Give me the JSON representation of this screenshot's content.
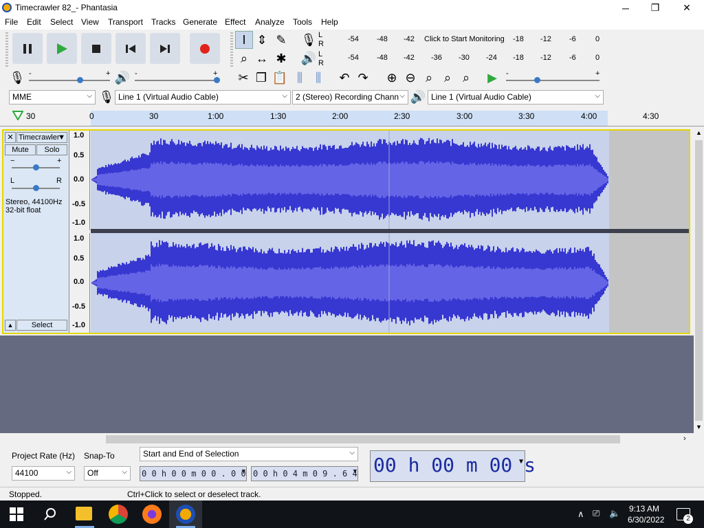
{
  "window": {
    "title": "Timecrawler 82_- Phantasia",
    "minimize": "─",
    "maximize": "❐",
    "close": "✕"
  },
  "menu": [
    "File",
    "Edit",
    "Select",
    "View",
    "Transport",
    "Tracks",
    "Generate",
    "Effect",
    "Analyze",
    "Tools",
    "Help"
  ],
  "meters": {
    "record_label_top": "L",
    "record_label_bottom": "R",
    "play_label_top": "L",
    "play_label_bottom": "R",
    "record_ticks": [
      "-54",
      "-48",
      "-42",
      "-18",
      "-12",
      "-6",
      "0"
    ],
    "monitor_text": "Click to Start Monitoring",
    "play_ticks": [
      "-54",
      "-48",
      "-42",
      "-36",
      "-30",
      "-24",
      "-18",
      "-12",
      "-6",
      "0"
    ]
  },
  "mixer": {
    "minus": "-",
    "plus": "+"
  },
  "devices": {
    "host": "MME",
    "recording_device": "Line 1 (Virtual Audio Cable)",
    "channels": "2 (Stereo) Recording Chann",
    "playback_device": "Line 1 (Virtual Audio Cable)"
  },
  "ruler": {
    "ticks": [
      "30",
      "0",
      "30",
      "1:00",
      "1:30",
      "2:00",
      "2:30",
      "3:00",
      "3:30",
      "4:00",
      "4:30"
    ]
  },
  "track": {
    "name": "Timecrawler",
    "mute": "Mute",
    "solo": "Solo",
    "gain_minus": "−",
    "gain_plus": "+",
    "pan_left": "L",
    "pan_right": "R",
    "info_line1": "Stereo, 44100Hz",
    "info_line2": "32-bit float",
    "select": "Select",
    "scale": [
      "1.0",
      "0.5",
      "0.0",
      "-0.5",
      "-1.0"
    ]
  },
  "bottom": {
    "project_rate_label": "Project Rate (Hz)",
    "project_rate": "44100",
    "snap_label": "Snap-To",
    "snap_value": "Off",
    "selection_mode": "Start and End of Selection",
    "sel_start": "0 0 h 0 0 m 0 0 . 0 0 0 s",
    "sel_end": "0 0 h 0 4 m 0 9 . 6 4 0 s",
    "clock": "00 h 00 m 00 s"
  },
  "status": {
    "left": "Stopped.",
    "right": "Ctrl+Click to select or deselect track."
  },
  "taskbar": {
    "time": "9:13 AM",
    "date": "6/30/2022",
    "notifications": "2"
  }
}
